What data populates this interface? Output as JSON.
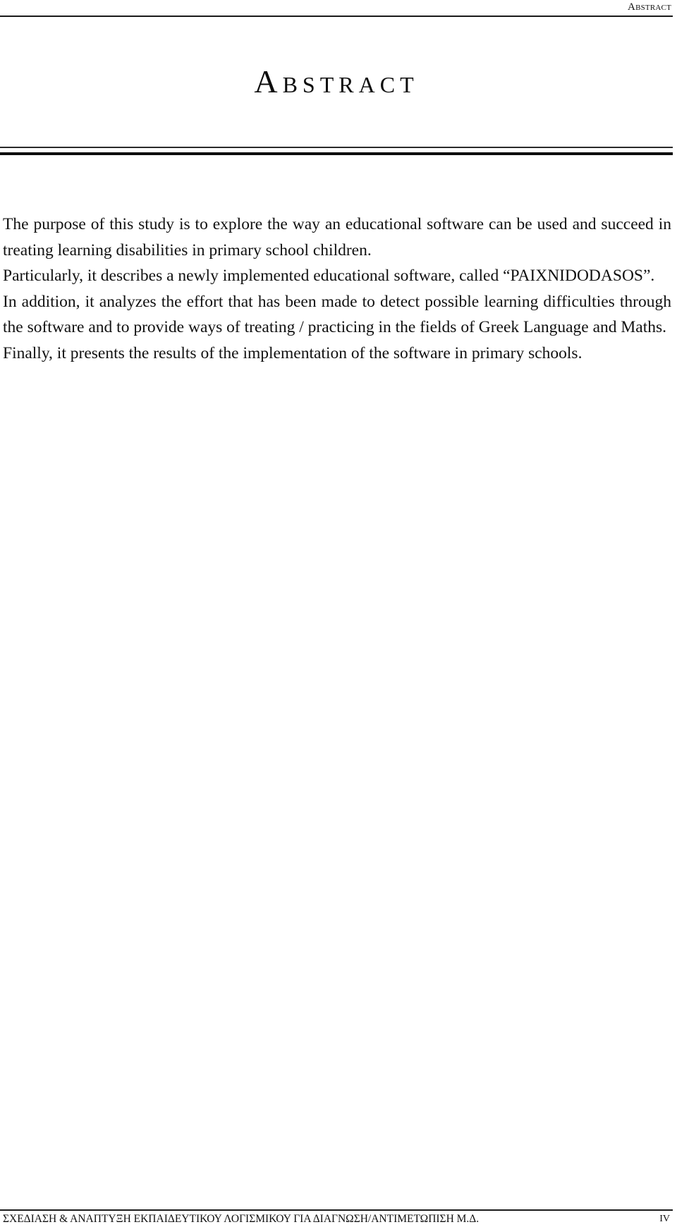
{
  "header": {
    "running_title": "Abstract"
  },
  "title": "Abstract",
  "body": {
    "paragraphs": [
      "The purpose of this study is to explore the way an educational software can be used and succeed in treating learning disabilities in primary school children.",
      "Particularly, it describes a newly implemented educational software, called “PAIXNIDODASOS”.",
      "In addition, it analyzes the effort that has been made to detect possible learning difficulties through the software and to provide ways of treating / practicing in the fields of Greek Language and Maths.",
      "Finally, it presents the results of the implementation of the software in primary schools."
    ]
  },
  "footer": {
    "running_title": "ΣΧΕΔΙΑΣΗ & ΑΝΑΠΤΥΞΗ ΕΚΠΑΙΔΕΥΤΙΚΟΥ ΛΟΓΙΣΜΙΚΟΥ ΓΙΑ ΔΙΑΓΝΩΣΗ/ΑΝΤΙΜΕΤΩΠΙΣΗ Μ.Δ.",
    "page_number": "IV"
  }
}
